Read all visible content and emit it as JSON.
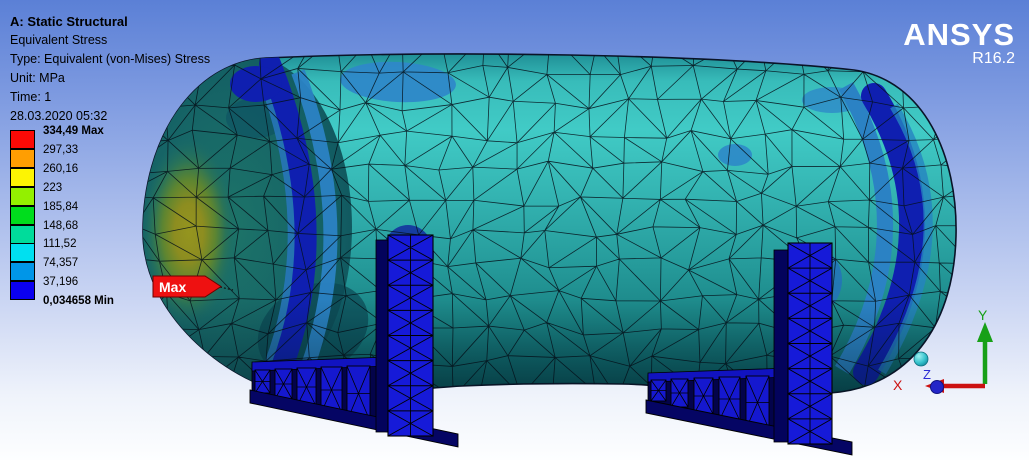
{
  "outline": {
    "title": "A: Static Structural",
    "result": "Equivalent Stress",
    "type": "Type: Equivalent (von-Mises) Stress",
    "unit": "Unit: MPa",
    "time": "Time: 1",
    "timestamp": "28.03.2020 05:32"
  },
  "brand": {
    "name": "ANSYS",
    "release": "R16.2"
  },
  "legend": {
    "labels": [
      "334,49 Max",
      "297,33",
      "260,16",
      "223",
      "185,84",
      "148,68",
      "111,52",
      "74,357",
      "37,196",
      "0,034658 Min"
    ],
    "colors": [
      "#fb0a06",
      "#ff9e02",
      "#fdf403",
      "#93f000",
      "#00dd1d",
      "#00dc9b",
      "#00e0f0",
      "#0096e8",
      "#0b00f0"
    ]
  },
  "annotations": {
    "max_flag": "Max"
  },
  "triad": {
    "axes": [
      {
        "label": "X",
        "color": "#c40e0e"
      },
      {
        "label": "Y",
        "color": "#12a012"
      },
      {
        "label": "Z",
        "color": "#2a2ad4"
      }
    ]
  },
  "model_colors": {
    "surface_teal": "#33b3b1",
    "low_stress_blue": "#0f1fb0",
    "mid_low_sky": "#2e88c8",
    "hotspot_olive": "#8d8d20",
    "support_blue": "#161ad8"
  }
}
